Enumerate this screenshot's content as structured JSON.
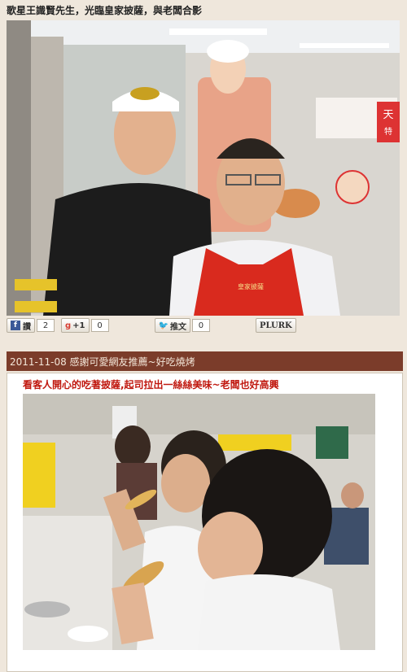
{
  "top_caption": "歌星王識賢先生，光臨皇家披薩，與老闆合影",
  "photo1": {
    "store_sign_cutout": "皇家披薩",
    "side_sign": "天",
    "side_sign_sub": "特",
    "apron_text": "皇家披薩"
  },
  "share": {
    "facebook_label": "讚",
    "facebook_count": "2",
    "google_label": "+1",
    "google_count": "0",
    "twitter_label": "推文",
    "twitter_count": "0",
    "plurk_label": "PLURK"
  },
  "post": {
    "header": "2011-11-08 感謝可愛網友推薦~好吃燒烤",
    "caption": "看客人開心的吃著披薩,起司拉出一絲絲美味~老闆也好高興"
  },
  "colors": {
    "header_bg": "#7b3c2a",
    "caption_red": "#c0180f",
    "page_bg": "#efe7dc"
  }
}
